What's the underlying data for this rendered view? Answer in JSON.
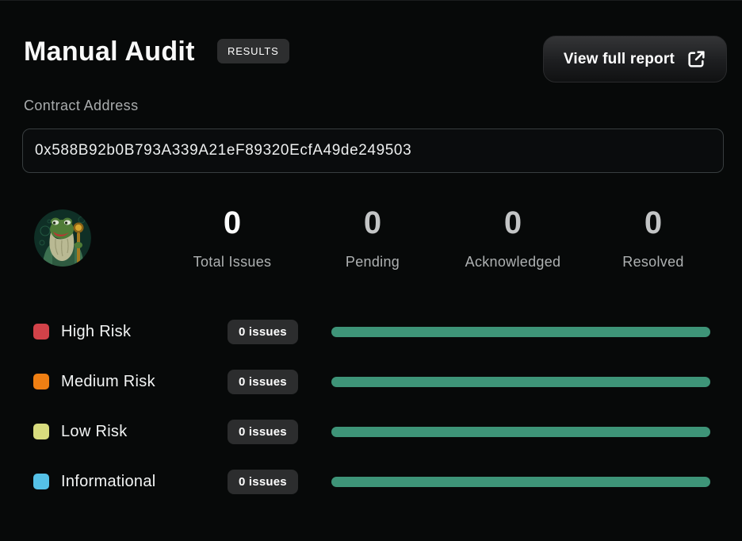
{
  "header": {
    "title": "Manual Audit",
    "results_badge": "RESULTS",
    "view_report_button": {
      "label": "View full report",
      "icon": "external-link-icon"
    }
  },
  "contract": {
    "label": "Contract Address",
    "address": "0x588B92b0B793A339A21eF89320EcfA49de249503"
  },
  "summary": {
    "avatar": "pepe-wizard",
    "stats": [
      {
        "value": "0",
        "label": "Total Issues",
        "value_color": "#fbfcfc"
      },
      {
        "value": "0",
        "label": "Pending",
        "value_color": "#c3c5c6"
      },
      {
        "value": "0",
        "label": "Acknowledged",
        "value_color": "#c3c5c6"
      },
      {
        "value": "0",
        "label": "Resolved",
        "value_color": "#c3c5c6"
      }
    ]
  },
  "risks": [
    {
      "label": "High Risk",
      "count": "0 issues",
      "swatch_color": "#d24249",
      "bar_width": "100%"
    },
    {
      "label": "Medium Risk",
      "count": "0 issues",
      "swatch_color": "#ef7f13",
      "bar_width": "100%"
    },
    {
      "label": "Low Risk",
      "count": "0 issues",
      "swatch_color": "#d8dc7e",
      "bar_width": "100%"
    },
    {
      "label": "Informational",
      "count": "0 issues",
      "swatch_color": "#55c1e7",
      "bar_width": "100%"
    }
  ],
  "colors": {
    "bar_fill": "#3e9478",
    "badge_bg": "#2c2d2e",
    "background": "#070909"
  }
}
